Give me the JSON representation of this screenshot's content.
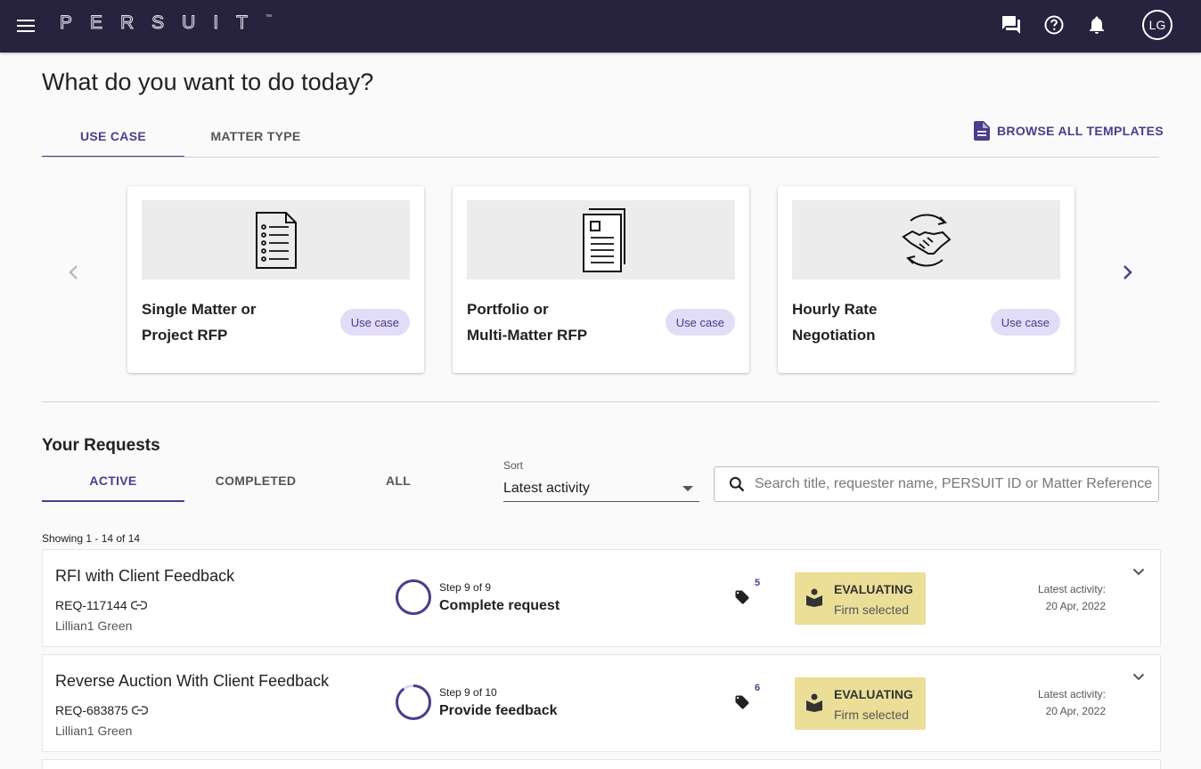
{
  "header": {
    "brand": "PERSUIT",
    "trademark": "™",
    "avatar_initials": "LG",
    "icons": [
      "menu-icon",
      "chat-icon",
      "help-icon",
      "bell-icon"
    ]
  },
  "page_title": "What do you want to do today?",
  "template_tabs": [
    {
      "label": "USE CASE",
      "active": true
    },
    {
      "label": "MATTER TYPE",
      "active": false
    }
  ],
  "browse_label": "BROWSE ALL TEMPLATES",
  "cards": [
    {
      "title": "Single Matter or\nProject RFP",
      "chip": "Use case",
      "icon": "checklist-document-icon"
    },
    {
      "title": "Portfolio or\nMulti-Matter RFP",
      "chip": "Use case",
      "icon": "stacked-documents-icon"
    },
    {
      "title": "Hourly Rate\nNegotiation",
      "chip": "Use case",
      "icon": "handshake-cycle-icon"
    }
  ],
  "requests": {
    "title": "Your Requests",
    "tabs": [
      {
        "label": "ACTIVE",
        "active": true
      },
      {
        "label": "COMPLETED",
        "active": false
      },
      {
        "label": "ALL",
        "active": false
      }
    ],
    "sort_label": "Sort",
    "sort_value": "Latest activity",
    "search_placeholder": "Search title, requester name, PERSUIT ID or Matter Reference",
    "showing": "Showing 1 - 14 of 14",
    "items": [
      {
        "title": "RFI with Client Feedback",
        "id": "REQ-117144",
        "owner": "Lillian1 Green",
        "step": "Step 9 of 9",
        "step_name": "Complete request",
        "progress": 1.0,
        "tag_count": "5",
        "status": "EVALUATING",
        "status_sub": "Firm selected",
        "latest_label": "Latest activity:",
        "latest_date": "20 Apr, 2022"
      },
      {
        "title": "Reverse Auction With Client Feedback",
        "id": "REQ-683875",
        "owner": "Lillian1 Green",
        "step": "Step 9 of 10",
        "step_name": "Provide feedback",
        "progress": 0.9,
        "tag_count": "6",
        "status": "EVALUATING",
        "status_sub": "Firm selected",
        "latest_label": "Latest activity:",
        "latest_date": "20 Apr, 2022"
      }
    ]
  },
  "colors": {
    "header_bg": "#27223d",
    "accent": "#4a3d8c",
    "chip_bg": "#e2dcf6",
    "status_bg": "#ebdf98"
  }
}
